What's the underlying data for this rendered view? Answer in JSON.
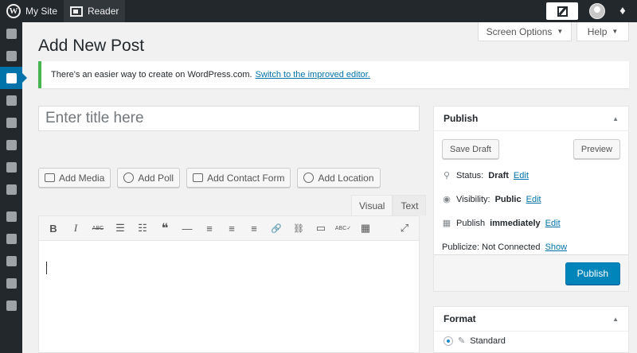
{
  "topbar": {
    "my_site": "My Site",
    "reader": "Reader"
  },
  "header": {
    "screen_options": "Screen Options",
    "help": "Help",
    "page_title": "Add New Post"
  },
  "notice": {
    "text": "There's an easier way to create on WordPress.com.",
    "link": "Switch to the improved editor."
  },
  "title_input": {
    "placeholder": "Enter title here"
  },
  "media_buttons": [
    "Add Media",
    "Add Poll",
    "Add Contact Form",
    "Add Location"
  ],
  "editor": {
    "tabs": [
      "Visual",
      "Text"
    ],
    "active_tab": "Visual",
    "toolbar": {
      "bold": "B",
      "italic": "I",
      "strike": "ABC",
      "ul": "☰",
      "ol": "☷",
      "quote": "❝",
      "hr": "—",
      "align_left": "≡",
      "align_center": "≡",
      "align_right": "≡",
      "link": "🔗",
      "unlink": "⛓",
      "more": "▭",
      "spell": "ABC✓",
      "kitchen": "▦",
      "fullscreen": "⤢"
    }
  },
  "publish": {
    "title": "Publish",
    "save_draft": "Save Draft",
    "preview": "Preview",
    "status_label": "Status:",
    "status_value": "Draft",
    "visibility_label": "Visibility:",
    "visibility_value": "Public",
    "publish_label": "Publish",
    "publish_value": "immediately",
    "edit": "Edit",
    "publicize_label": "Publicize: Not Connected",
    "publicize_link": "Show",
    "publish_button": "Publish"
  },
  "format": {
    "title": "Format",
    "option": "Standard"
  },
  "colors": {
    "admin_bar": "#23282d",
    "accent": "#0073aa",
    "notice_border": "#46b450",
    "primary_button": "#0085ba"
  },
  "icons": {
    "logo": "wordpress-logo-icon",
    "reader": "reader-icon",
    "write": "write-icon",
    "avatar": "avatar-icon",
    "notifications": "bell-icon",
    "side_menu": [
      "dashboard-icon",
      "store-icon",
      "posts-icon",
      "media-icon",
      "links-icon",
      "pages-icon",
      "comments-icon",
      "feedback-icon",
      "appearance-icon",
      "plugins-icon",
      "users-icon",
      "tools-icon",
      "settings-icon"
    ]
  }
}
